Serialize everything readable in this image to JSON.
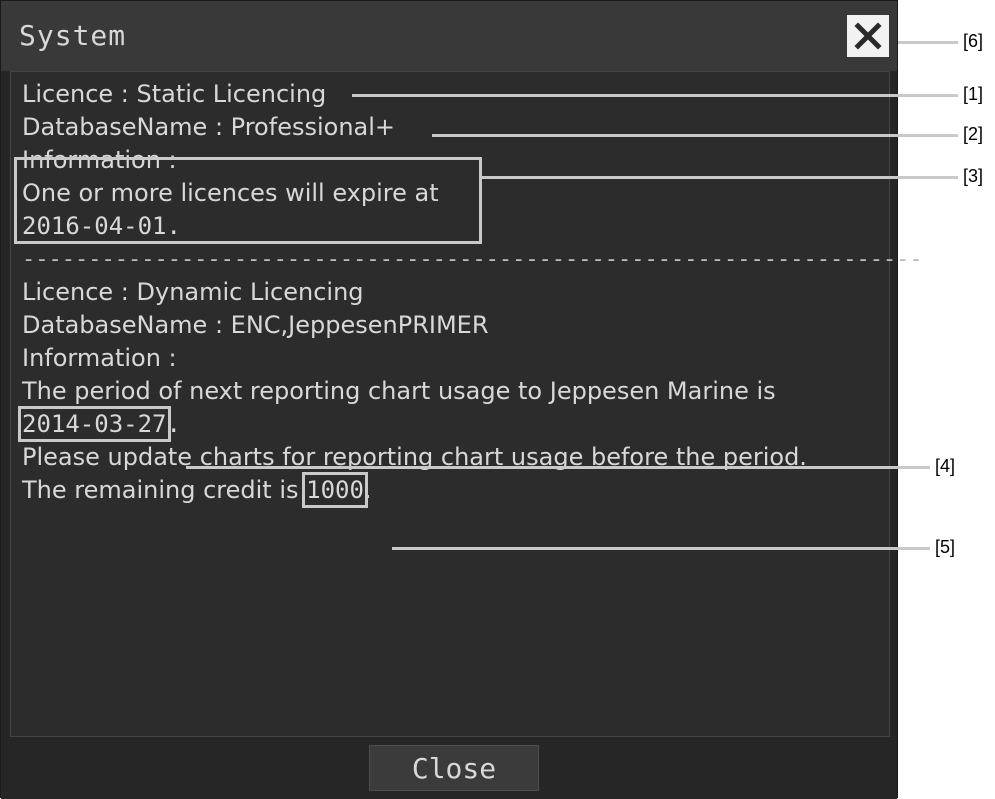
{
  "window": {
    "title": "System",
    "close_button_label": "Close"
  },
  "content": {
    "block1": {
      "licence_line": "Licence : Static Licencing",
      "database_line": "DatabaseName : Professional+",
      "information_label": "Information :",
      "info_text_1": "One or more licences will expire at",
      "info_text_2": "2016-04-01."
    },
    "separator": "--------------------------------------------------------------------",
    "block2": {
      "licence_line": "Licence : Dynamic Licencing",
      "database_line": "DatabaseName : ENC,JeppesenPRIMER",
      "information_label": "Information :",
      "period_text": "The period of next reporting chart usage to Jeppesen Marine is",
      "period_date": "2014-03-27",
      "period_suffix": ".",
      "update_text": "Please update charts for reporting chart usage before the period.",
      "credit_prefix": "The remaining credit is ",
      "credit_value": "1000",
      "credit_suffix": "."
    }
  },
  "callouts": {
    "c1": "[1]",
    "c2": "[2]",
    "c3": "[3]",
    "c4": "[4]",
    "c5": "[5]",
    "c6": "[6]"
  },
  "icons": {
    "close": "close-x-icon"
  }
}
